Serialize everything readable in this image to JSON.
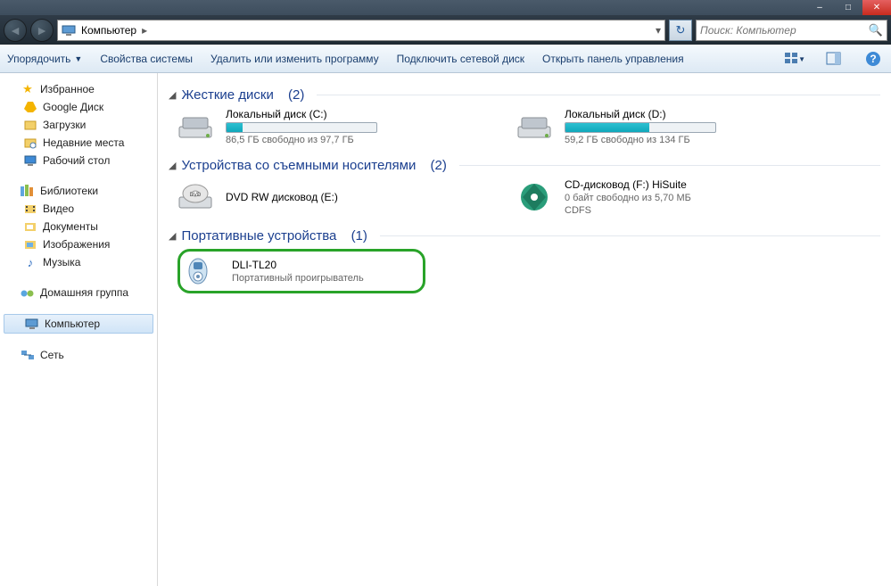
{
  "window_controls": {
    "min": "–",
    "max": "□",
    "close": "✕"
  },
  "breadcrumb": {
    "root": "Компьютер",
    "sep": "▸"
  },
  "search": {
    "placeholder": "Поиск: Компьютер"
  },
  "toolbar": {
    "organize": "Упорядочить",
    "system_props": "Свойства системы",
    "uninstall": "Удалить или изменить программу",
    "map_drive": "Подключить сетевой диск",
    "control_panel": "Открыть панель управления"
  },
  "sidebar": {
    "favorites": {
      "label": "Избранное",
      "items": [
        {
          "icon": "google-drive-icon",
          "label": "Google Диск"
        },
        {
          "icon": "downloads-icon",
          "label": "Загрузки"
        },
        {
          "icon": "recent-icon",
          "label": "Недавние места"
        },
        {
          "icon": "desktop-icon",
          "label": "Рабочий стол"
        }
      ]
    },
    "libraries": {
      "label": "Библиотеки",
      "items": [
        {
          "icon": "video-icon",
          "label": "Видео"
        },
        {
          "icon": "documents-icon",
          "label": "Документы"
        },
        {
          "icon": "pictures-icon",
          "label": "Изображения"
        },
        {
          "icon": "music-icon",
          "label": "Музыка"
        }
      ]
    },
    "homegroup": {
      "label": "Домашняя группа"
    },
    "computer": {
      "label": "Компьютер"
    },
    "network": {
      "label": "Сеть"
    }
  },
  "sections": {
    "hdd": {
      "title": "Жесткие диски",
      "count": "(2)"
    },
    "removable": {
      "title": "Устройства со съемными носителями",
      "count": "(2)"
    },
    "portable": {
      "title": "Портативные устройства",
      "count": "(1)"
    }
  },
  "drives": {
    "c": {
      "name": "Локальный диск (C:)",
      "free": "86,5 ГБ свободно из 97,7 ГБ",
      "fill_pct": 11
    },
    "d": {
      "name": "Локальный диск (D:)",
      "free": "59,2 ГБ свободно из 134 ГБ",
      "fill_pct": 56
    },
    "e": {
      "name": "DVD RW дисковод (E:)"
    },
    "f": {
      "name": "CD-дисковод (F:) HiSuite",
      "free": "0 байт свободно из 5,70 МБ",
      "fs": "CDFS"
    }
  },
  "portable_device": {
    "name": "DLI-TL20",
    "sub": "Портативный проигрыватель"
  }
}
